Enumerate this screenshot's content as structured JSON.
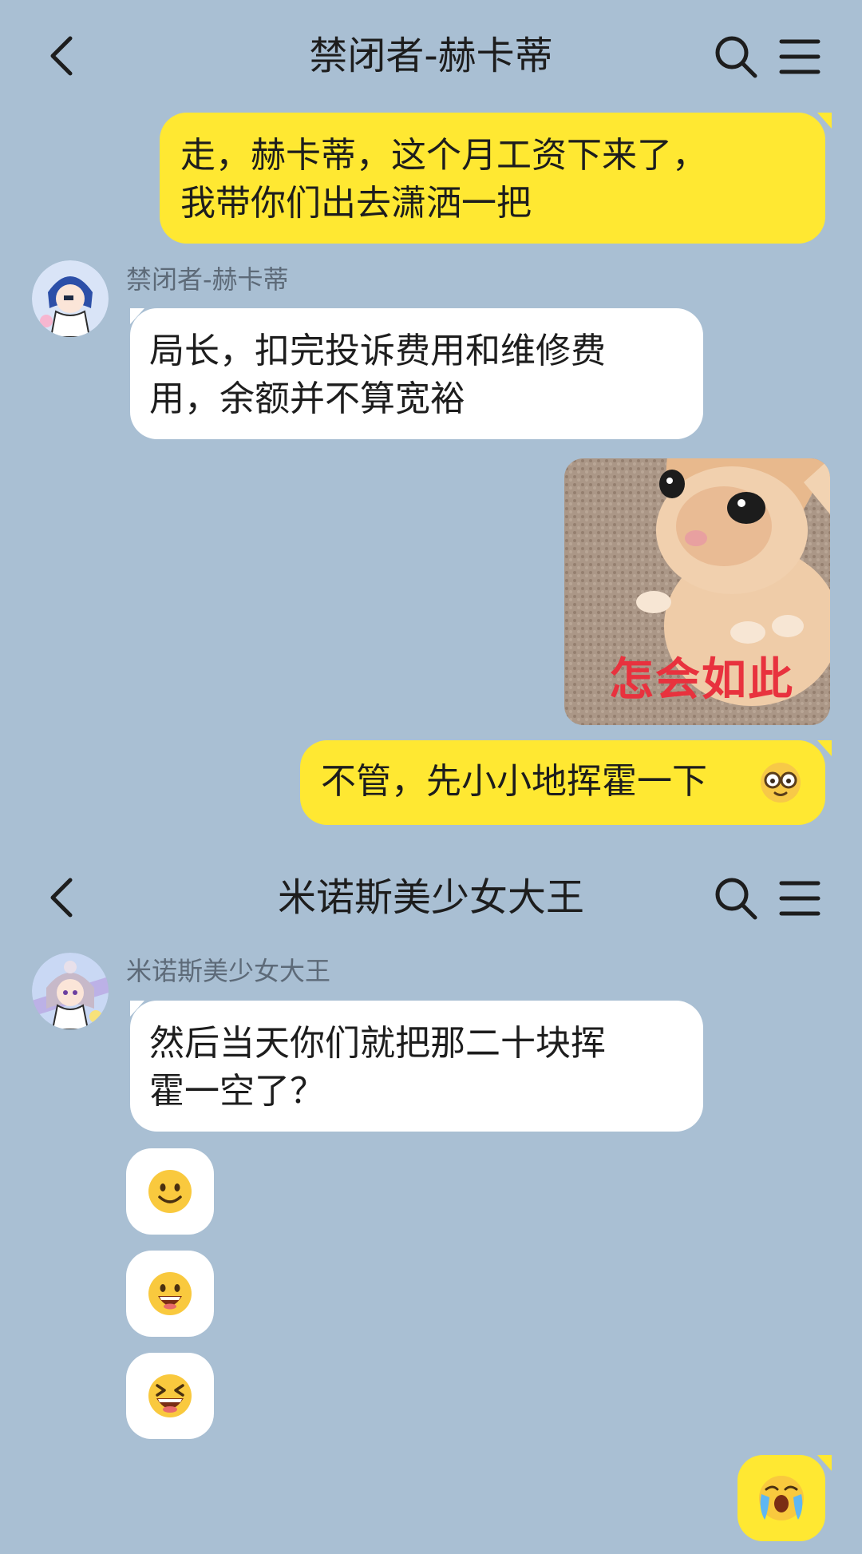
{
  "chat1": {
    "title": "禁闭者-赫卡蒂",
    "messages": [
      {
        "from": "me",
        "text_line1": "走，赫卡蒂，这个月工资下来了，",
        "text_line2": "我带你们出去潇洒一把"
      },
      {
        "from": "them",
        "sender": "禁闭者-赫卡蒂",
        "text_line1": "局长，扣完投诉费用和维修费",
        "text_line2": "用，余额并不算宽裕"
      },
      {
        "from": "me",
        "type": "image",
        "caption": "怎会如此"
      },
      {
        "from": "me",
        "text": "不管，先小小地挥霍一下",
        "emoji": "nerd-glasses-emoji"
      }
    ]
  },
  "chat2": {
    "title": "米诺斯美少女大王",
    "messages": [
      {
        "from": "them",
        "sender": "米诺斯美少女大王",
        "text_line1": "然后当天你们就把那二十块挥",
        "text_line2": "霍一空了？"
      },
      {
        "from": "them",
        "type": "emoji",
        "emoji": "slight-smile-emoji"
      },
      {
        "from": "them",
        "type": "emoji",
        "emoji": "grin-emoji"
      },
      {
        "from": "them",
        "type": "emoji",
        "emoji": "laughing-squint-emoji"
      },
      {
        "from": "me",
        "type": "emoji",
        "emoji": "crying-scream-emoji"
      }
    ]
  },
  "colors": {
    "background": "#a9bfd3",
    "my_bubble": "#ffe832",
    "their_bubble": "#ffffff",
    "caption": "#e8323e"
  }
}
